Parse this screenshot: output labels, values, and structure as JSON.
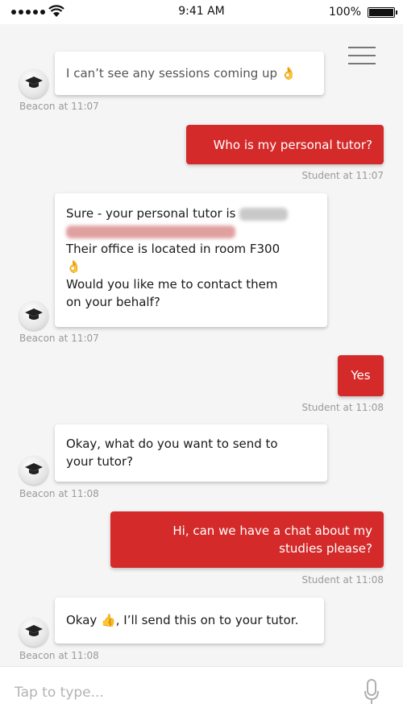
{
  "status_bar": {
    "time": "9:41 AM",
    "battery": "100%"
  },
  "messages": [
    {
      "from": "bot",
      "text": "I can’t see any sessions coming up",
      "meta": "Beacon at 11:07"
    },
    {
      "from": "user",
      "text": "Who is my personal tutor?",
      "meta": "Student at 11:07"
    },
    {
      "from": "bot",
      "line1": "Sure - your personal tutor is",
      "line3": "Their office is located in room F300",
      "line5": "Would you like me to contact them",
      "line6": "on your behalf?",
      "meta": "Beacon at 11:07"
    },
    {
      "from": "user",
      "text": "Yes",
      "meta": "Student at 11:08"
    },
    {
      "from": "bot",
      "line1": "Okay, what do you want to send to",
      "line2": "your tutor?",
      "meta": "Beacon at 11:08"
    },
    {
      "from": "user",
      "line1": "Hi, can we have a chat about my",
      "line2": "studies please?",
      "meta": "Student at 11:08"
    },
    {
      "from": "bot",
      "before": "Okay ",
      "after": ", I’ll send this on to your tutor.",
      "meta": "Beacon at 11:08"
    }
  ],
  "input": {
    "placeholder": "Tap to type..."
  },
  "colors": {
    "user_bubble": "#d42a2a",
    "bot_bubble": "#ffffff",
    "background": "#f5f5f5",
    "meta_text": "#9a9a9a"
  }
}
